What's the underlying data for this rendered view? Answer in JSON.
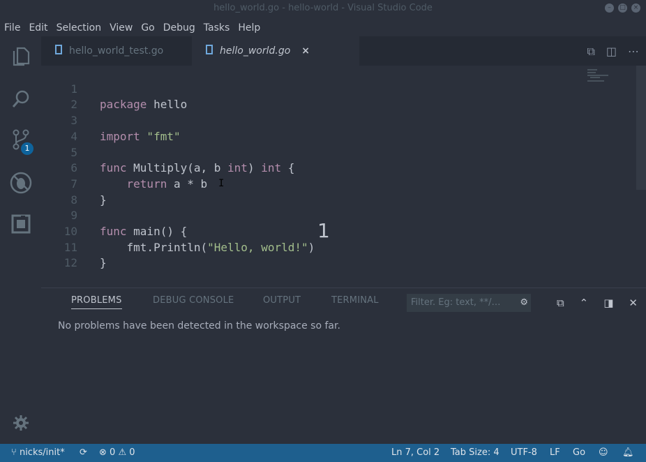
{
  "window": {
    "title": "hello_world.go - hello-world - Visual Studio Code"
  },
  "menu": [
    "File",
    "Edit",
    "Selection",
    "View",
    "Go",
    "Debug",
    "Tasks",
    "Help"
  ],
  "activity": {
    "icons": [
      "files-icon",
      "search-icon",
      "source-control-icon",
      "debug-icon",
      "extensions-icon",
      "settings-gear-icon"
    ],
    "scm_badge": "1"
  },
  "tabs": [
    {
      "label": "hello_world_test.go",
      "active": false
    },
    {
      "label": "hello_world.go",
      "active": true,
      "close": "×"
    }
  ],
  "editor": {
    "lines": [
      {
        "n": "1"
      },
      {
        "n": "2"
      },
      {
        "n": "3"
      },
      {
        "n": "4"
      },
      {
        "n": "5"
      },
      {
        "n": "6"
      },
      {
        "n": "7"
      },
      {
        "n": "8"
      },
      {
        "n": "9"
      },
      {
        "n": "10"
      },
      {
        "n": "11"
      },
      {
        "n": "12"
      }
    ],
    "tokens": {
      "l1a": "package",
      "l1b": " hello",
      "l3a": "import",
      "l3b": " \"fmt\"",
      "l5a": "func",
      "l5b": " Multiply(a, b ",
      "l5c": "int",
      "l5d": ") ",
      "l5e": "int",
      "l5f": " {",
      "l6a": "    return",
      "l6b": " a * b",
      "l7a": "}",
      "l9a": "func",
      "l9b": " main() {",
      "l10a": "    fmt.Println(",
      "l10b": "\"Hello, world!\"",
      "l10c": ")",
      "l11a": "}"
    },
    "overlay_number": "1"
  },
  "panel": {
    "tabs": [
      "PROBLEMS",
      "DEBUG CONSOLE",
      "OUTPUT",
      "TERMINAL"
    ],
    "filter_placeholder": "Filter. Eg: text, **/…",
    "message": "No problems have been detected in the workspace so far."
  },
  "status": {
    "branch": "nicks/init*",
    "errors": "0",
    "warnings": "0",
    "position": "Ln 7, Col 2",
    "tab_size": "Tab Size: 4",
    "encoding": "UTF-8",
    "eol": "LF",
    "language": "Go"
  },
  "colors": {
    "status_bar": "#1e5f8e",
    "editor_bg": "#2b303b",
    "badge": "#0e639c"
  }
}
